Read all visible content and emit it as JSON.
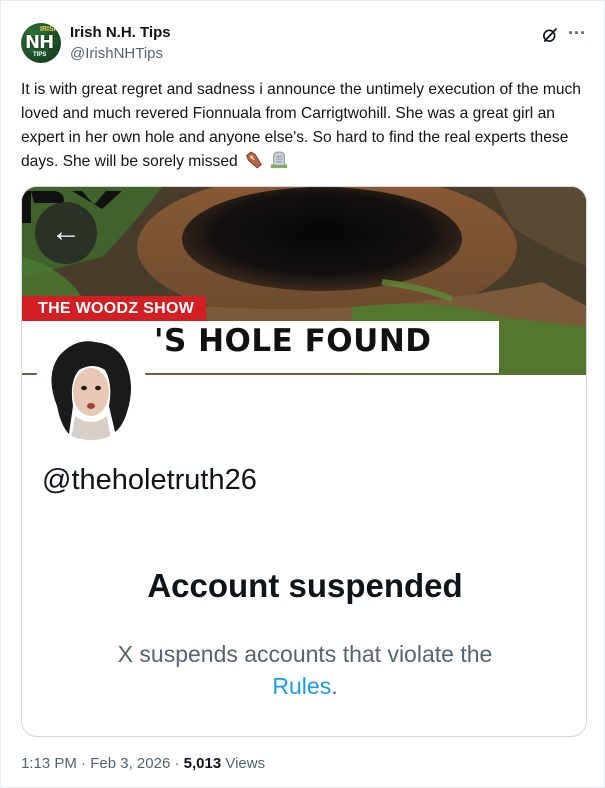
{
  "author": {
    "name": "Irish N.H. Tips",
    "handle": "@IrishNHTips",
    "avatar_text": "NH",
    "avatar_small_top": "IRISH",
    "avatar_small_bottom": "TIPS"
  },
  "icons": {
    "grok": "grok-icon",
    "more": "more-icon",
    "back": "back-arrow-icon",
    "emoji1": "coffin-emoji",
    "emoji2": "headstone-emoji"
  },
  "more_symbol": "···",
  "tweet": {
    "text": "It is with great regret and sadness i announce the untimely execution of the much loved and much revered Fionnuala from Carrigtwohill. She was a great girl an expert in her own hole and anyone else's. So hard to find the real experts these days. She will be sorely missed"
  },
  "media": {
    "show_banner": "THE WOODZ SHOW",
    "headline": "'S HOLE FOUND",
    "back_arrow": "←",
    "suspended_handle": "@theholetruth26",
    "suspended_title": "Account suspended",
    "suspended_desc": "X suspends accounts that violate the",
    "rules_link": "Rules",
    "rules_suffix": "."
  },
  "meta": {
    "time": "1:13 PM",
    "sep1": " · ",
    "date": "Feb 3, 2026",
    "sep2": " · ",
    "views_count": "5,013",
    "views_label": " Views"
  },
  "colors": {
    "accent": "#1d9bf0",
    "banner_red": "#d11f24",
    "secondary_text": "#536471"
  }
}
